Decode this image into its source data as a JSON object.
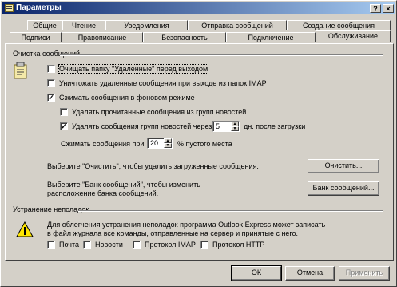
{
  "window": {
    "title": "Параметры",
    "help_glyph": "?",
    "close_glyph": "×"
  },
  "tabs_back": [
    "Общие",
    "Чтение",
    "Уведомления",
    "Отправка сообщений",
    "Создание сообщения"
  ],
  "tabs_front": [
    "Подписи",
    "Правописание",
    "Безопасность",
    "Подключение",
    "Обслуживание"
  ],
  "active_tab": "Обслуживание",
  "cleanup": {
    "group_label": "Очистка сообщений",
    "empty_deleted_label": "Очищать папку \"Удаленные\" перед выходом",
    "empty_deleted_checked": false,
    "purge_imap_label": "Уничтожать удаленные сообщения при выходе из папок IMAP",
    "purge_imap_checked": false,
    "compact_bg_label": "Сжимать сообщения в фоновом режиме",
    "compact_bg_checked": true,
    "delete_read_news_label": "Удалять прочитанные сообщения из групп новостей",
    "delete_read_news_checked": false,
    "delete_news_after_label": "Удалять сообщения групп новостей через",
    "delete_news_after_checked": true,
    "delete_news_days": "5",
    "delete_news_days_suffix": "дн. после загрузки",
    "compact_at_label": "Сжимать сообщения при",
    "compact_at_value": "20",
    "compact_at_suffix": "% пустого места",
    "clean_up_desc": "Выберите \"Очистить\", чтобы удалить загруженные сообщения.",
    "clean_up_button": "Очистить...",
    "store_desc_line1": "Выберите \"Банк сообщений\", чтобы изменить",
    "store_desc_line2": "расположение банка сообщений.",
    "store_button": "Банк сообщений..."
  },
  "troubleshooting": {
    "group_label": "Устранение неполадок",
    "desc_line1": "Для облегчения устранения неполадок программа Outlook Express может записать",
    "desc_line2": "в файл журнала все команды, отправленные на сервер и принятые с него.",
    "options": [
      {
        "label": "Почта",
        "checked": false
      },
      {
        "label": "Новости",
        "checked": false
      },
      {
        "label": "Протокол IMAP",
        "checked": false
      },
      {
        "label": "Протокол HTTP",
        "checked": false
      }
    ]
  },
  "footer": {
    "ok": "ОК",
    "cancel": "Отмена",
    "apply": "Применить"
  },
  "icons": {
    "checkmark": "✓",
    "spin_up": "▲",
    "spin_down": "▼"
  }
}
